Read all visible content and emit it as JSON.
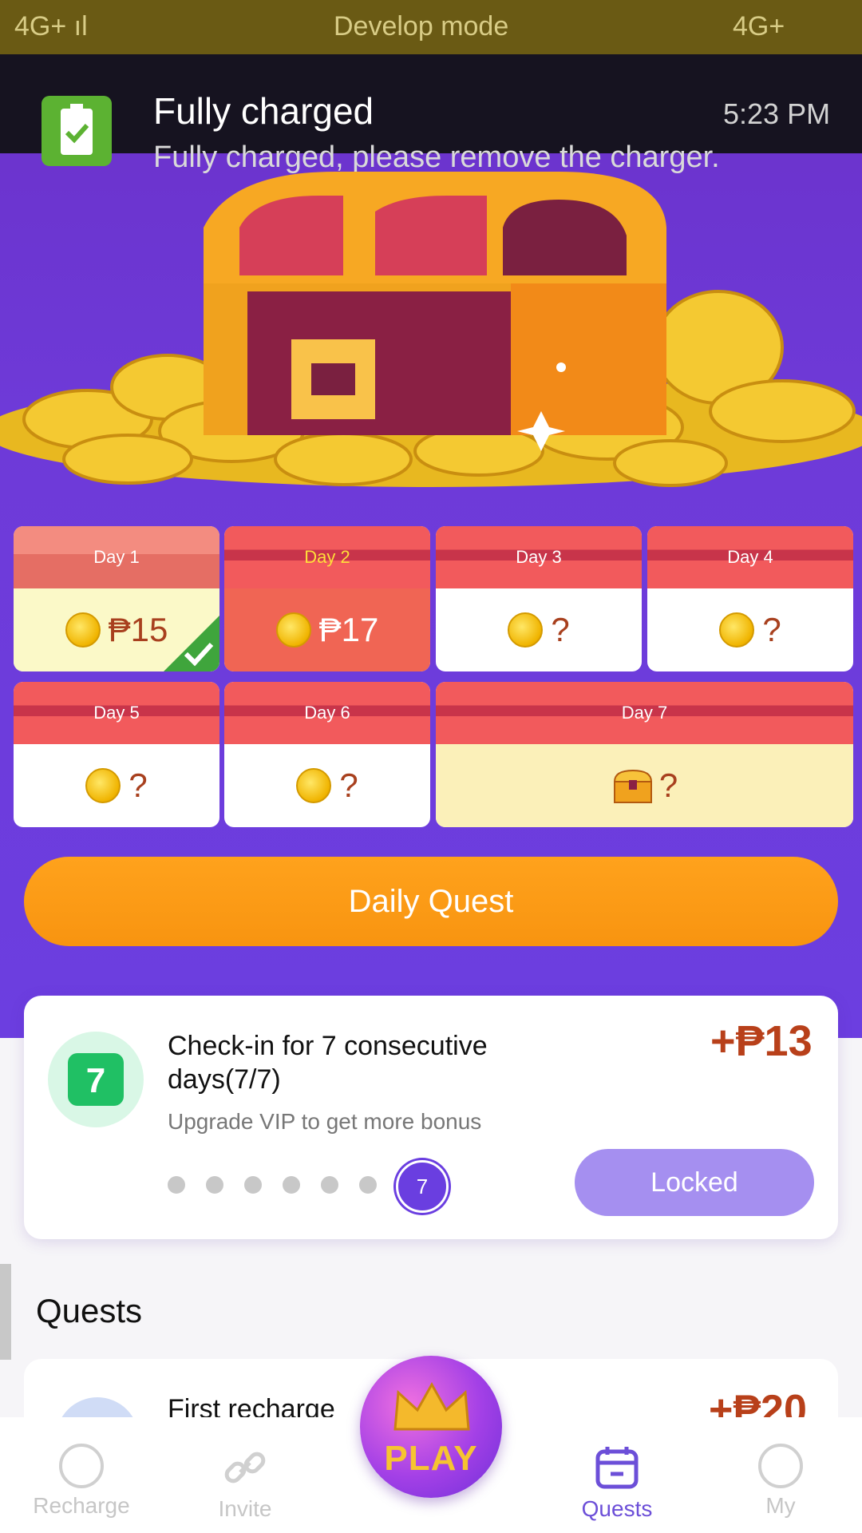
{
  "status_bar": {
    "left": "4G+ ıl",
    "center": "Develop mode",
    "right": "4G+"
  },
  "notification": {
    "title": "Fully charged",
    "time": "5:23 PM",
    "body": "Fully charged, please remove the charger."
  },
  "days": [
    {
      "label": "Day 1",
      "reward": "₱15"
    },
    {
      "label": "Day 2",
      "reward": "₱17"
    },
    {
      "label": "Day 3",
      "reward": "?"
    },
    {
      "label": "Day 4",
      "reward": "?"
    },
    {
      "label": "Day 5",
      "reward": "?"
    },
    {
      "label": "Day 6",
      "reward": "?"
    },
    {
      "label": "Day 7",
      "reward": "?"
    }
  ],
  "daily_quest_label": "Daily Quest",
  "checkin_card": {
    "icon_number": "7",
    "title": "Check-in for 7 consecutive days(7/7)",
    "bonus": "+₱13",
    "subtitle": "Upgrade VIP to get more bonus",
    "current_day": "7",
    "button_label": "Locked"
  },
  "quests": {
    "heading": "Quests",
    "first_title": "First recharge",
    "first_bonus": "+₱20"
  },
  "nav": {
    "recharge": "Recharge",
    "invite": "Invite",
    "play": "PLAY",
    "quests": "Quests",
    "my": "My"
  },
  "colors": {
    "purple": "#6c3ee0",
    "orange": "#f89410",
    "reward_red": "#b8401a",
    "active_nav": "#6c4fd8"
  }
}
